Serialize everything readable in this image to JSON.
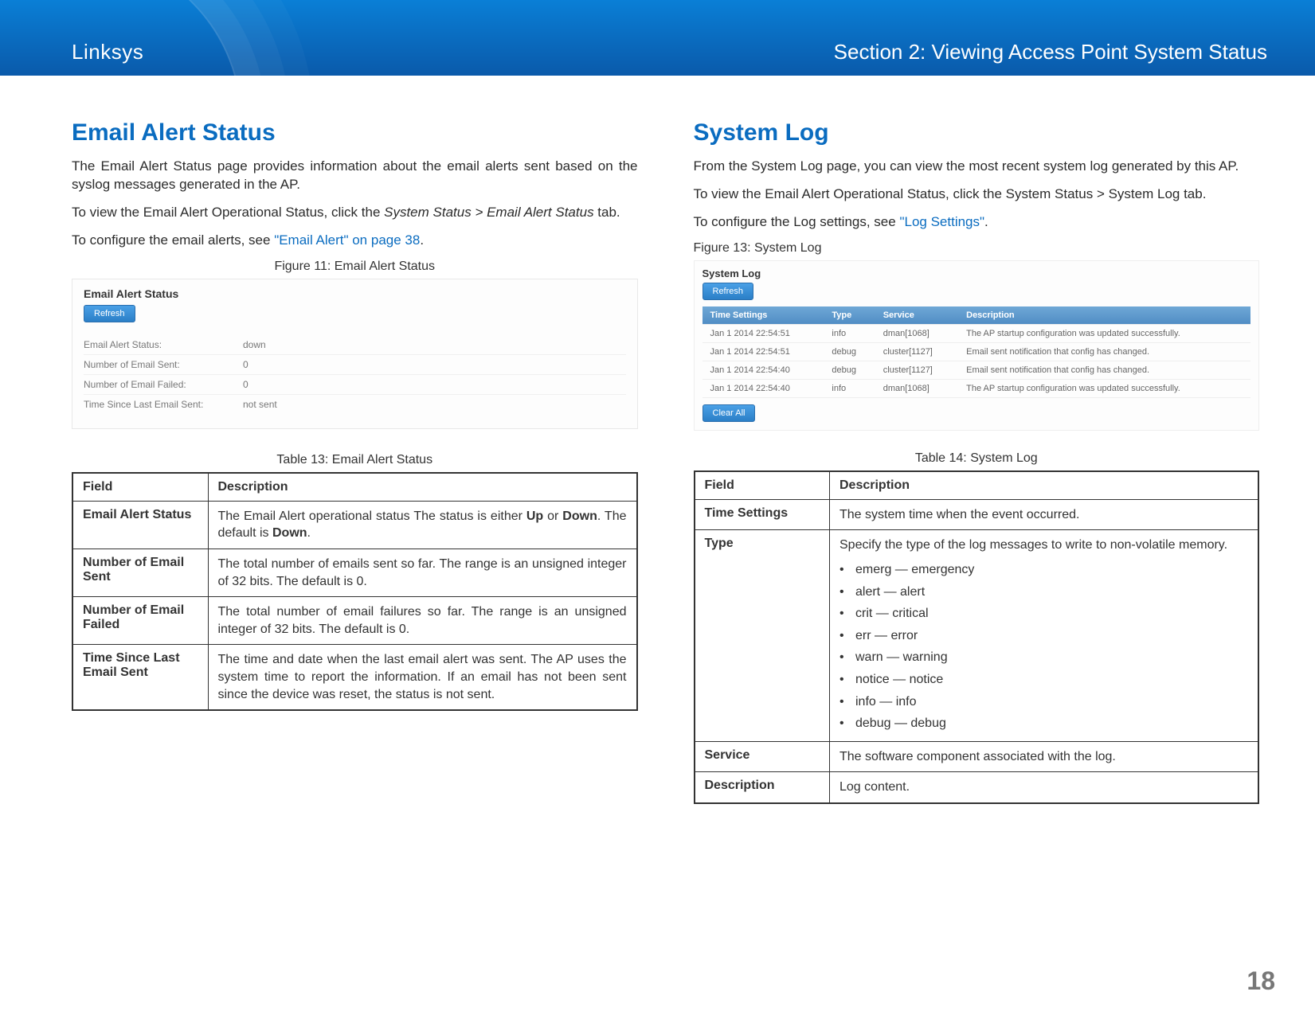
{
  "header": {
    "brand": "Linksys",
    "section": "Section 2:  Viewing Access Point System Status"
  },
  "left": {
    "heading": "Email Alert Status",
    "p1": "The Email Alert Status page provides information about the email alerts sent based on the syslog messages generated in the AP.",
    "p2a": "To view the Email Alert Operational Status, click the ",
    "p2b": "System Status > Email Alert Status",
    "p2c": " tab.",
    "p3a": "To configure the email alerts, see ",
    "p3link": "\"Email Alert\" on page 38",
    "p3b": ".",
    "fig_caption": "Figure 11: Email Alert Status",
    "fig": {
      "title": "Email Alert Status",
      "refresh": "Refresh",
      "rows": [
        {
          "label": "Email Alert Status:",
          "value": "down"
        },
        {
          "label": "Number of Email Sent:",
          "value": "0"
        },
        {
          "label": "Number of Email Failed:",
          "value": "0"
        },
        {
          "label": "Time Since Last Email Sent:",
          "value": "not sent"
        }
      ]
    },
    "table_caption": "Table 13: Email Alert Status",
    "table": {
      "h_field": "Field",
      "h_desc": "Description",
      "rows": [
        {
          "field": "Email Alert Status",
          "desc_pre": "The Email Alert operational status The status is either ",
          "b1": "Up",
          "mid": " or ",
          "b2": "Down",
          "mid2": ". The default is ",
          "b3": "Down",
          "post": "."
        },
        {
          "field": "Number of Email Sent",
          "desc": "The total number of emails sent so far. The range is an unsigned integer of 32 bits. The default is 0."
        },
        {
          "field": "Number of Email Failed",
          "desc": "The total number of email failures so far. The range is an unsigned integer of 32 bits. The default is 0."
        },
        {
          "field": "Time Since Last Email Sent",
          "desc": "The time and date when the last email alert was sent. The AP uses the system time to report the information. If an email has not been sent since the device was reset, the status is not sent."
        }
      ]
    }
  },
  "right": {
    "heading": "System Log",
    "p1": "From the System Log page, you can view the most recent system log generated by this AP.",
    "p2": "To view the Email Alert Operational Status, click the System Status > System Log tab.",
    "p3a": "To configure the Log settings, see ",
    "p3link": "\"Log Settings\"",
    "p3b": ".",
    "fig_caption": "Figure 13: System Log",
    "fig": {
      "title": "System Log",
      "refresh": "Refresh",
      "clear": "Clear All",
      "headers": {
        "time": "Time Settings",
        "type": "Type",
        "service": "Service",
        "desc": "Description"
      },
      "rows": [
        {
          "time": "Jan 1 2014 22:54:51",
          "type": "info",
          "service": "dman[1068]",
          "desc": "The AP startup configuration was updated successfully."
        },
        {
          "time": "Jan 1 2014 22:54:51",
          "type": "debug",
          "service": "cluster[1127]",
          "desc": "Email sent notification that config has changed."
        },
        {
          "time": "Jan 1 2014 22:54:40",
          "type": "debug",
          "service": "cluster[1127]",
          "desc": "Email sent notification that config has changed."
        },
        {
          "time": "Jan 1 2014 22:54:40",
          "type": "info",
          "service": "dman[1068]",
          "desc": "The AP startup configuration was updated successfully."
        }
      ]
    },
    "table_caption": "Table 14: System Log",
    "table": {
      "h_field": "Field",
      "h_desc": "Description",
      "rows": [
        {
          "field": "Time Settings",
          "desc": "The system time when the event occurred."
        },
        {
          "field": "Type",
          "desc_intro": "Specify the type of the log messages to write to non-volatile memory.",
          "items": [
            "emerg — emergency",
            "alert — alert",
            "crit — critical",
            "err — error",
            "warn — warning",
            "notice — notice",
            "info — info",
            "debug — debug"
          ]
        },
        {
          "field": "Service",
          "desc": "The software component associated with the log."
        },
        {
          "field": "Description",
          "desc": "Log content."
        }
      ]
    }
  },
  "page_number": "18"
}
